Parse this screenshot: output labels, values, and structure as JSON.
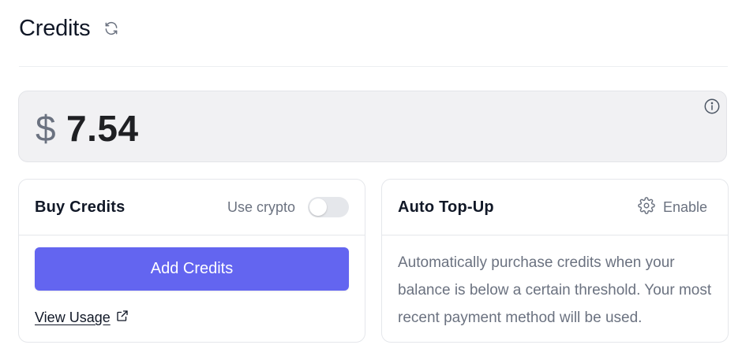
{
  "header": {
    "title": "Credits"
  },
  "balance": {
    "currency": "$",
    "amount": "7.54"
  },
  "buy": {
    "title": "Buy Credits",
    "crypto_label": "Use crypto",
    "crypto_enabled": false,
    "button_label": "Add Credits",
    "usage_link": "View Usage"
  },
  "topup": {
    "title": "Auto Top-Up",
    "enable_label": "Enable",
    "description": "Automatically purchase credits when your balance is below a certain threshold. Your most recent payment method will be used."
  },
  "colors": {
    "accent": "#6365f0",
    "muted": "#6b7280",
    "balance_bg": "#f1f1f3"
  },
  "icons": {
    "refresh": "refresh-icon",
    "info": "info-icon",
    "gear": "gear-icon",
    "external": "external-link-icon"
  }
}
